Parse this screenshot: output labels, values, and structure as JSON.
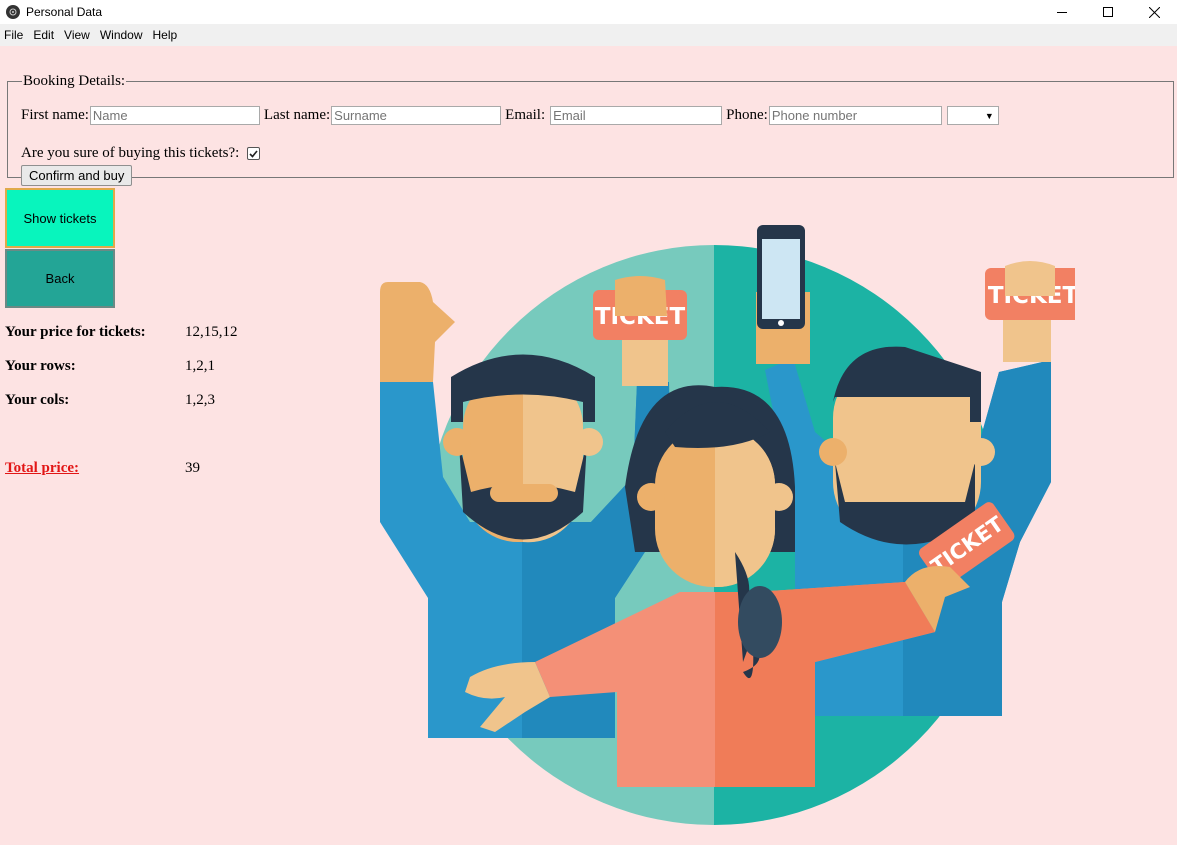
{
  "window": {
    "title": "Personal Data",
    "controls": [
      "minimize-icon",
      "maximize-icon",
      "close-icon"
    ]
  },
  "menu": [
    "File",
    "Edit",
    "View",
    "Window",
    "Help"
  ],
  "booking": {
    "legend": "Booking Details:",
    "first_name_label": "First name:",
    "first_name_placeholder": "Name",
    "last_name_label": "Last name:",
    "last_name_placeholder": "Surname",
    "email_label": "Email:",
    "email_placeholder": "Email",
    "phone_label": "Phone:",
    "phone_placeholder": "Phone number",
    "phone_code_value": "",
    "confirm_question": "Are you sure of buying this tickets?:",
    "confirm_checked": true,
    "confirm_button": "Confirm and buy"
  },
  "actions": {
    "show_tickets": "Show tickets",
    "back": "Back"
  },
  "summary": {
    "price_label": "Your price for tickets:",
    "price_value": "12,15,12",
    "rows_label": "Your rows:",
    "rows_value": "1,2,1",
    "cols_label": "Your cols:",
    "cols_value": "1,2,3",
    "total_label": "Total price:",
    "total_value": "39"
  },
  "illustration": {
    "ticket_text": "TICKET"
  },
  "colors": {
    "background": "#fde3e3",
    "show_tickets_button": "#08f5bd",
    "back_button": "#23a596",
    "total_label": "#e21616"
  }
}
